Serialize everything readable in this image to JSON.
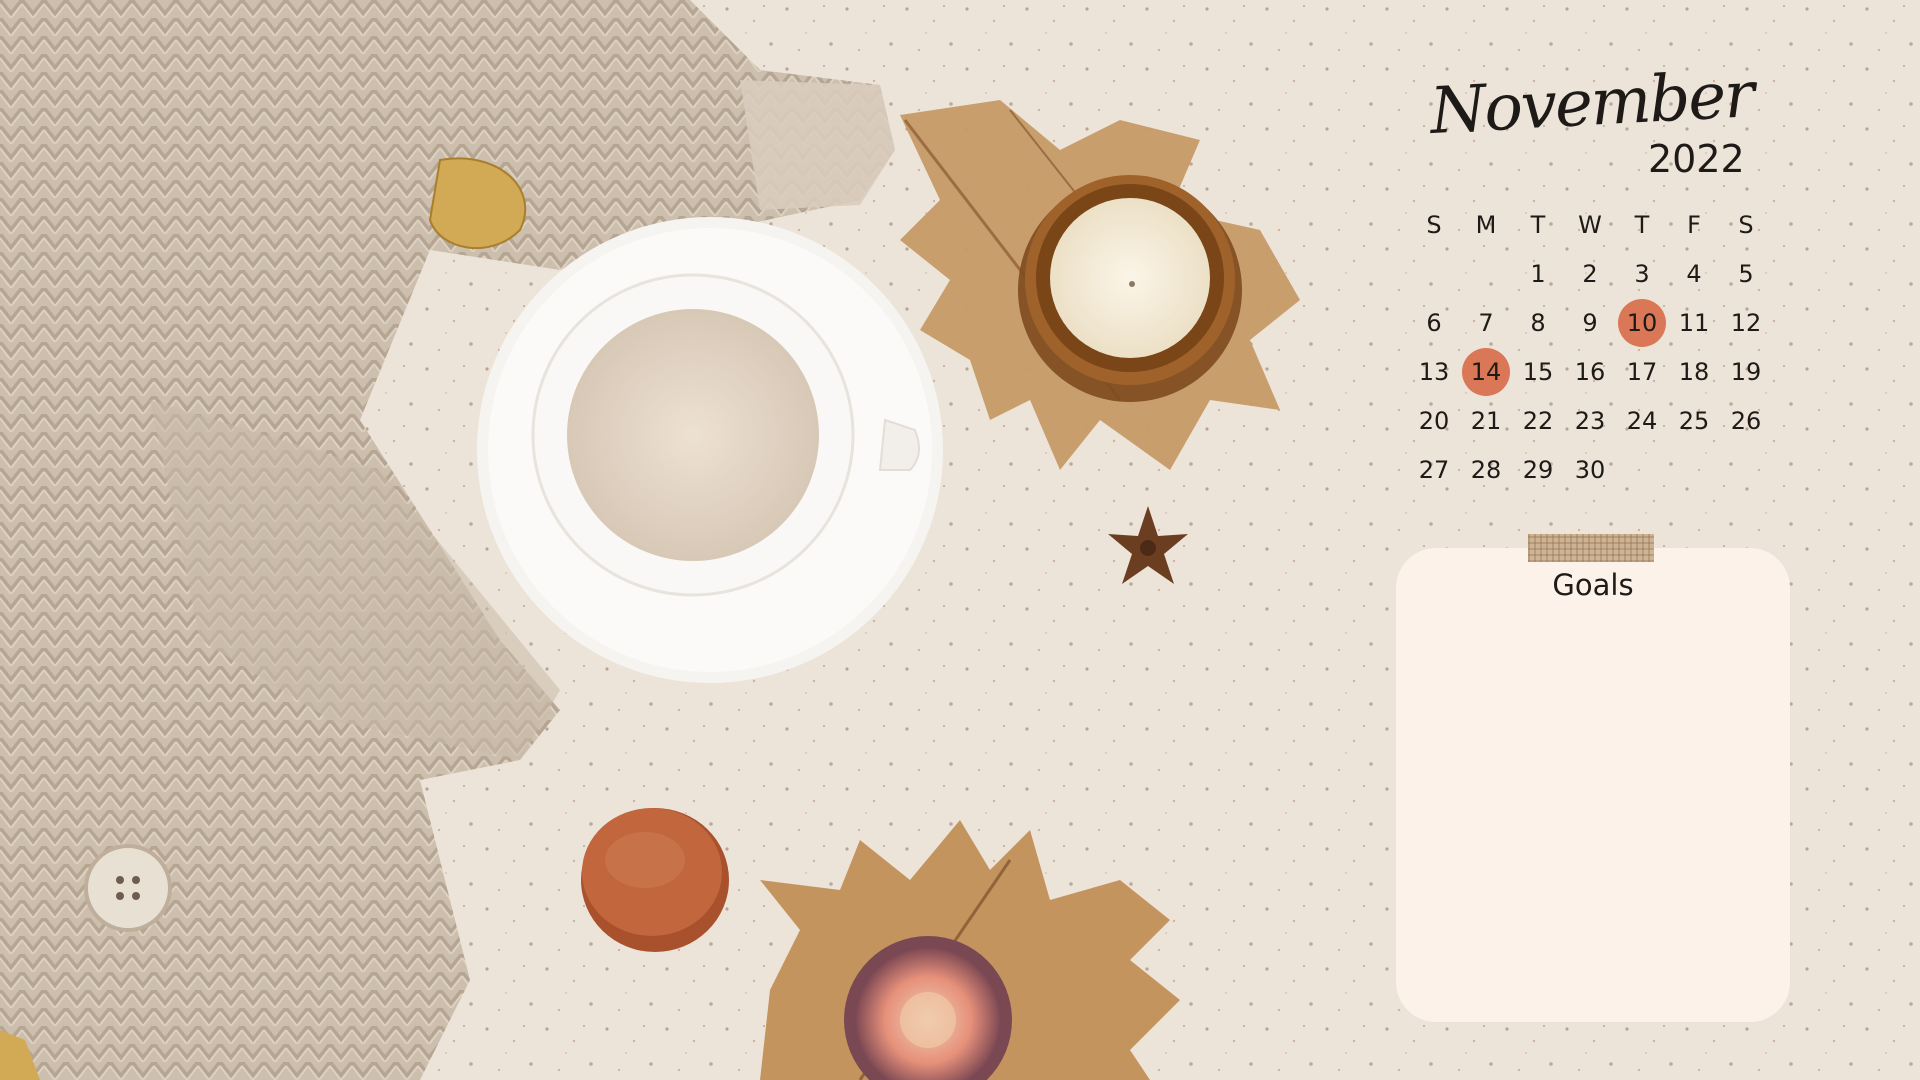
{
  "calendar": {
    "month": "November",
    "year": "2022",
    "weekdays": [
      "S",
      "M",
      "T",
      "W",
      "T",
      "F",
      "S"
    ],
    "days": [
      "",
      "",
      "1",
      "2",
      "3",
      "4",
      "5",
      "6",
      "7",
      "8",
      "9",
      "10",
      "11",
      "12",
      "13",
      "14",
      "15",
      "16",
      "17",
      "18",
      "19",
      "20",
      "21",
      "22",
      "23",
      "24",
      "25",
      "26",
      "27",
      "28",
      "29",
      "30",
      "",
      "",
      ""
    ],
    "highlighted_days": [
      "10",
      "14"
    ],
    "highlight_color": "#d97757"
  },
  "goals": {
    "title": "Goals",
    "card_color": "#fcf2ea"
  },
  "background": {
    "scene": "autumn flat-lay with knit sweater, cup of milk tea on saucer, candle in amber jar, dried maple leaves, star anise, macaron, fig",
    "base_color": "#ede4d9"
  }
}
